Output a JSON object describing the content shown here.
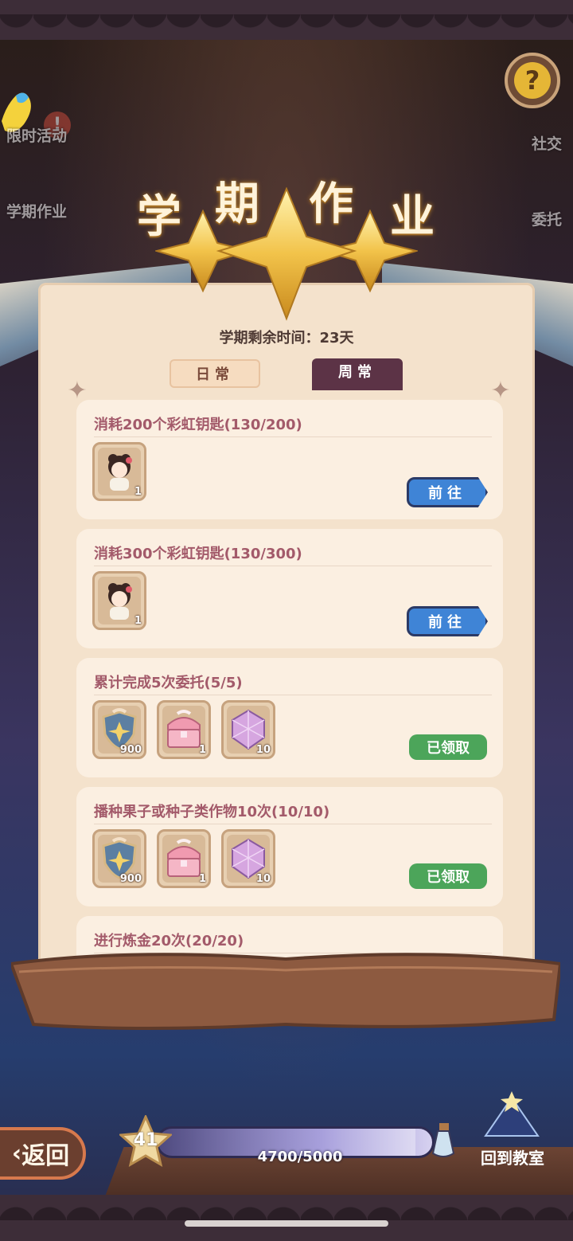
{
  "header": {
    "title_chars": [
      "学",
      "期",
      "作",
      "业"
    ],
    "help_label": "?"
  },
  "side_left": [
    {
      "label": "限时活动"
    },
    {
      "label": "学期作业"
    }
  ],
  "side_right": [
    {
      "label": "社交"
    },
    {
      "label": "委托"
    }
  ],
  "time_left": "学期剩余时间：23天",
  "tabs": [
    {
      "label": "日常",
      "active": false
    },
    {
      "label": "周常",
      "active": true
    }
  ],
  "tasks": [
    {
      "title": "消耗200个彩虹钥匙(130/200)",
      "rewards": [
        {
          "icon": "character-card-icon",
          "count": "1"
        }
      ],
      "button": "前往",
      "state": "go"
    },
    {
      "title": "消耗300个彩虹钥匙(130/300)",
      "rewards": [
        {
          "icon": "character-card-icon",
          "count": "1"
        }
      ],
      "button": "前往",
      "state": "go"
    },
    {
      "title": "累计完成5次委托(5/5)",
      "rewards": [
        {
          "icon": "shield-star-icon",
          "count": "900"
        },
        {
          "icon": "treasure-chest-icon",
          "count": "1"
        },
        {
          "icon": "pink-gem-icon",
          "count": "10"
        }
      ],
      "button": "已领取",
      "state": "done"
    },
    {
      "title": "播种果子或种子类作物10次(10/10)",
      "rewards": [
        {
          "icon": "shield-star-icon",
          "count": "900"
        },
        {
          "icon": "treasure-chest-icon",
          "count": "1"
        },
        {
          "icon": "pink-gem-icon",
          "count": "10"
        }
      ],
      "button": "已领取",
      "state": "done"
    },
    {
      "title": "进行炼金20次(20/20)",
      "rewards": [
        {
          "icon": "shield-star-icon",
          "count": ""
        },
        {
          "icon": "treasure-chest-icon",
          "count": ""
        },
        {
          "icon": "pink-gem-icon",
          "count": ""
        }
      ],
      "button": "",
      "state": "done"
    }
  ],
  "footer": {
    "back_label": "返回",
    "level": "41",
    "progress_text": "4700/5000",
    "progress_fraction": 0.94,
    "classroom_label": "回到教室"
  },
  "colors": {
    "task_title": "#a35a6a",
    "go_button": "#3f84d6",
    "done_button": "#4ca55a",
    "weekly_tab": "#5c3346"
  }
}
